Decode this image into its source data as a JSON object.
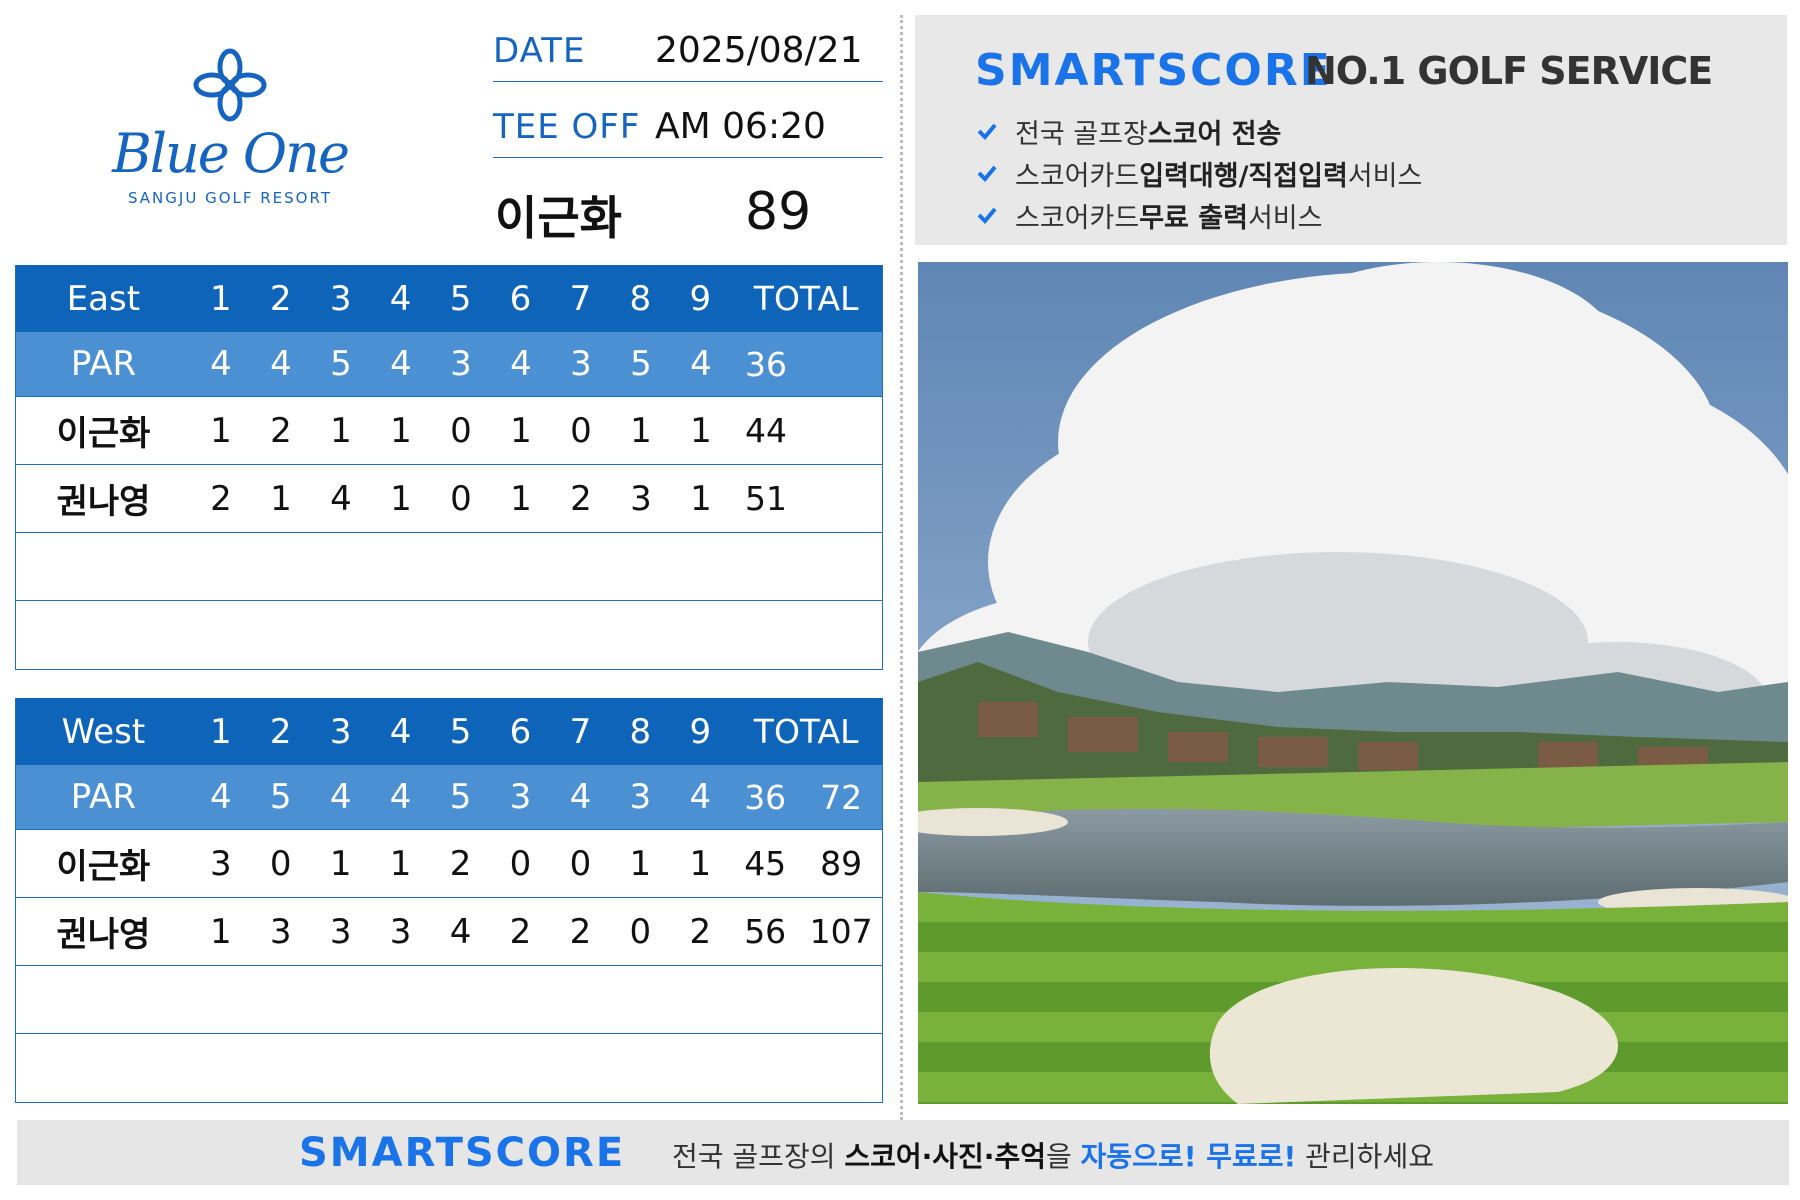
{
  "logo": {
    "name": "Blue One",
    "sub": "SANGJU GOLF RESORT"
  },
  "info": {
    "date_label": "DATE",
    "date_value": "2025/08/21",
    "teeoff_label": "TEE OFF",
    "teeoff_value": "AM 06:20",
    "lead_player": "이근화",
    "lead_score": "89"
  },
  "east": {
    "course": "East",
    "holes": [
      "1",
      "2",
      "3",
      "4",
      "5",
      "6",
      "7",
      "8",
      "9"
    ],
    "total_label": "TOTAL",
    "par_label": "PAR",
    "par": [
      "4",
      "4",
      "5",
      "4",
      "3",
      "4",
      "3",
      "5",
      "4"
    ],
    "par_total": "36",
    "players": [
      {
        "name": "이근화",
        "scores": [
          "1",
          "2",
          "1",
          "1",
          "0",
          "1",
          "0",
          "1",
          "1"
        ],
        "total": "44"
      },
      {
        "name": "권나영",
        "scores": [
          "2",
          "1",
          "4",
          "1",
          "0",
          "1",
          "2",
          "3",
          "1"
        ],
        "total": "51"
      }
    ]
  },
  "west": {
    "course": "West",
    "holes": [
      "1",
      "2",
      "3",
      "4",
      "5",
      "6",
      "7",
      "8",
      "9"
    ],
    "total_label": "TOTAL",
    "par_label": "PAR",
    "par": [
      "4",
      "5",
      "4",
      "4",
      "5",
      "3",
      "4",
      "3",
      "4"
    ],
    "par_total": "36",
    "par_grand": "72",
    "players": [
      {
        "name": "이근화",
        "scores": [
          "3",
          "0",
          "1",
          "1",
          "2",
          "0",
          "0",
          "1",
          "1"
        ],
        "total": "45",
        "grand": "89"
      },
      {
        "name": "권나영",
        "scores": [
          "1",
          "3",
          "3",
          "3",
          "4",
          "2",
          "2",
          "0",
          "2"
        ],
        "total": "56",
        "grand": "107"
      }
    ]
  },
  "ad": {
    "brand": "SMARTSCORE",
    "tagline": "NO.1 GOLF SERVICE",
    "items": [
      {
        "pre": "전국 골프장 ",
        "bold": "스코어 전송",
        "post": ""
      },
      {
        "pre": "스코어카드 ",
        "bold": "입력대행/직접입력",
        "post": " 서비스"
      },
      {
        "pre": "스코어카드 ",
        "bold": "무료 출력",
        "post": " 서비스"
      }
    ]
  },
  "footer": {
    "brand": "SMARTSCORE",
    "t1": "전국 골프장의 ",
    "t2": "스코어·사진·추억",
    "t3": "을 ",
    "t4": "자동으로! 무료로!",
    "t5": " 관리하세요"
  },
  "colors": {
    "brand_blue": "#1a73e8",
    "header_blue": "#0d64b8",
    "par_blue": "#4a90d2",
    "logo_blue": "#1565c0"
  }
}
